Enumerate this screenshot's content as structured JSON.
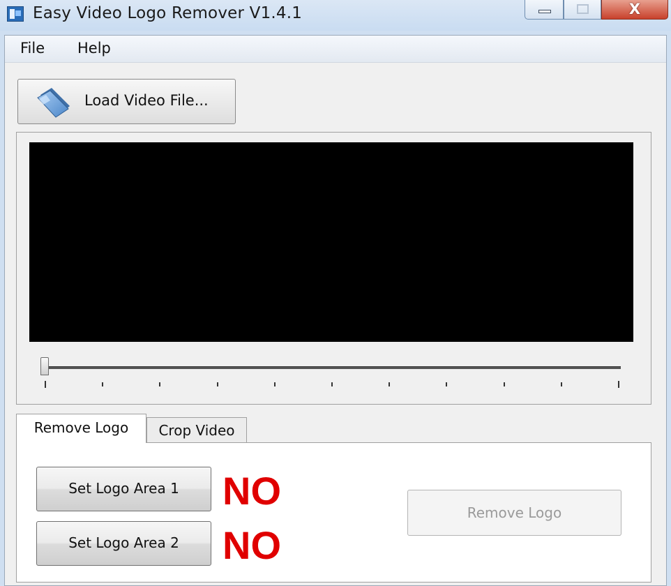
{
  "window": {
    "title": "Easy Video Logo Remover V1.4.1",
    "close_glyph": "X"
  },
  "menu": {
    "items": [
      "File",
      "Help"
    ]
  },
  "toolbar": {
    "load_label": "Load Video File...",
    "load_icon": "folder-icon"
  },
  "player": {
    "preview_color": "#000000",
    "seek_position": 0,
    "tick_count": 11
  },
  "tabs": [
    {
      "label": "Remove Logo",
      "selected": true
    },
    {
      "label": "Crop Video",
      "selected": false
    }
  ],
  "remove_logo_panel": {
    "set_area_1_label": "Set Logo Area 1",
    "set_area_1_status": "NO",
    "set_area_2_label": "Set Logo Area 2",
    "set_area_2_status": "NO",
    "remove_label": "Remove Logo",
    "remove_enabled": false,
    "status_color": "#e00000"
  }
}
